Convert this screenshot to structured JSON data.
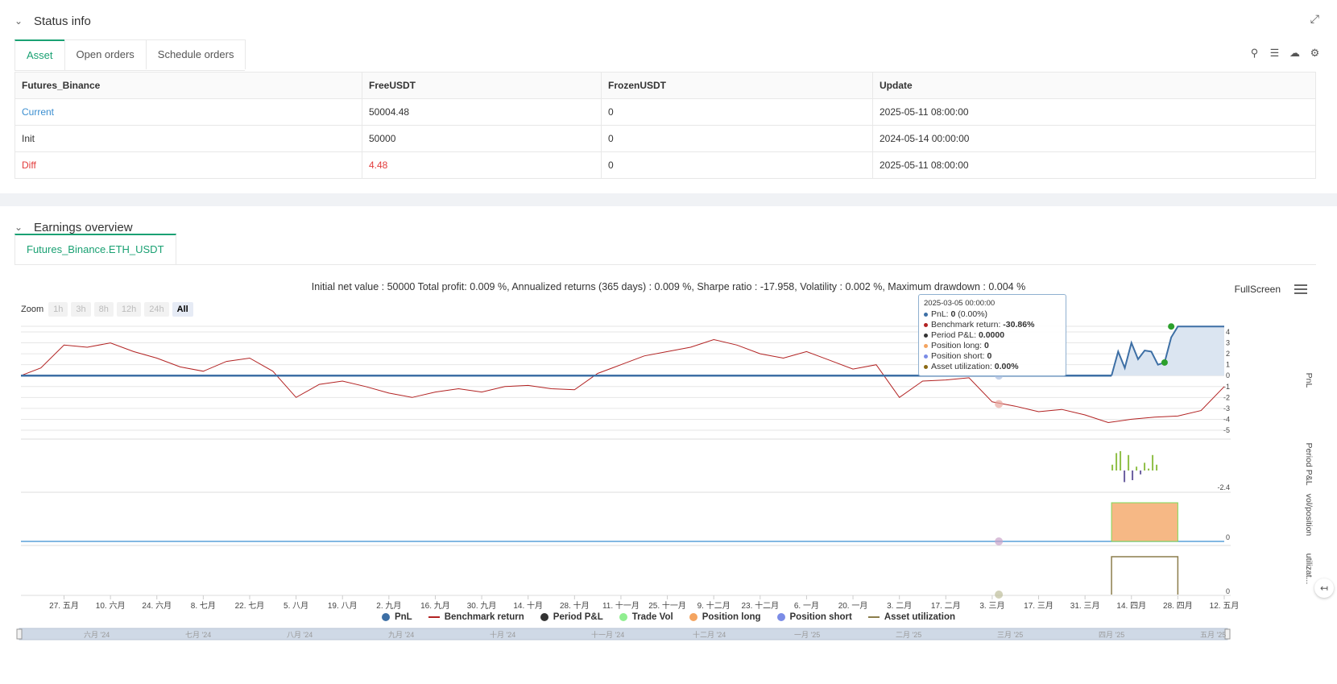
{
  "status": {
    "title": "Status info",
    "tabs": [
      "Asset",
      "Open orders",
      "Schedule orders"
    ],
    "table": {
      "headers": [
        "Futures_Binance",
        "FreeUSDT",
        "FrozenUSDT",
        "Update"
      ],
      "rows": [
        [
          "Current",
          "50004.48",
          "0",
          "2025-05-11 08:00:00"
        ],
        [
          "Init",
          "50000",
          "0",
          "2024-05-14 00:00:00"
        ],
        [
          "Diff",
          "4.48",
          "0",
          "2025-05-11 08:00:00"
        ]
      ]
    }
  },
  "earnings": {
    "title": "Earnings overview",
    "tab": "Futures_Binance.ETH_USDT",
    "summary": "Initial net value : 50000 Total profit: 0.009 %, Annualized returns (365 days) : 0.009 %, Sharpe ratio : -17.958, Volatility : 0.002 %, Maximum drawdown : 0.004 %",
    "fullscreen": "FullScreen",
    "zoom": {
      "label": "Zoom",
      "options": [
        "1h",
        "3h",
        "8h",
        "12h",
        "24h",
        "All"
      ],
      "active": "All"
    },
    "tooltip": {
      "date": "2025-03-05 00:00:00",
      "rows": [
        {
          "label": "PnL: ",
          "value": "0",
          "extra": " (0.00%)",
          "color": "#3d6fa5"
        },
        {
          "label": "Benchmark return: ",
          "value": "-30.86%",
          "extra": "",
          "color": "#b22222"
        },
        {
          "label": "Period P&L: ",
          "value": "0.0000",
          "extra": "",
          "color": "#333333"
        },
        {
          "label": "Position long: ",
          "value": "0",
          "extra": "",
          "color": "#f4a460"
        },
        {
          "label": "Position short: ",
          "value": "0",
          "extra": "",
          "color": "#7b8ce6"
        },
        {
          "label": "Asset utilization: ",
          "value": "0.00%",
          "extra": "",
          "color": "#8b6914"
        }
      ]
    },
    "legend": [
      {
        "label": "PnL",
        "type": "circle",
        "color": "#3d6fa5"
      },
      {
        "label": "Benchmark return",
        "type": "line",
        "color": "#b22222"
      },
      {
        "label": "Period P&L",
        "type": "circle",
        "color": "#333333"
      },
      {
        "label": "Trade Vol",
        "type": "circle",
        "color": "#90ee90"
      },
      {
        "label": "Position long",
        "type": "circle",
        "color": "#f4a460"
      },
      {
        "label": "Position short",
        "type": "circle",
        "color": "#7b8ce6"
      },
      {
        "label": "Asset utilization",
        "type": "line",
        "color": "#8b7d4b"
      }
    ],
    "axis_titles": [
      "PnL",
      "Period P&L",
      "vol/position",
      "utilizat..."
    ],
    "navigator_labels": [
      "六月 '24",
      "七月 '24",
      "八月 '24",
      "九月 '24",
      "十月 '24",
      "十一月 '24",
      "十二月 '24",
      "一月 '25",
      "二月 '25",
      "三月 '25",
      "四月 '25",
      "五月 '25"
    ]
  },
  "chart_data": {
    "type": "line",
    "x_tick_labels": [
      "27. 五月",
      "10. 六月",
      "24. 六月",
      "8. 七月",
      "22. 七月",
      "5. 八月",
      "19. 八月",
      "2. 九月",
      "16. 九月",
      "30. 九月",
      "14. 十月",
      "28. 十月",
      "11. 十一月",
      "25. 十一月",
      "9. 十二月",
      "23. 十二月",
      "6. 一月",
      "20. 一月",
      "3. 二月",
      "17. 二月",
      "3. 三月",
      "17. 三月",
      "31. 三月",
      "14. 四月",
      "28. 四月",
      "12. 五月"
    ],
    "pnl_y_ticks": [
      4,
      3,
      2,
      1,
      0,
      -1,
      -2,
      -3,
      -4,
      -5
    ],
    "pnl_ylim": [
      -5,
      4
    ],
    "period_pnl_tick": "-2.4",
    "vol_tick": "0",
    "util_tick": "0",
    "series": [
      {
        "name": "PnL",
        "dates": [
          "2025-04-08",
          "2025-04-10",
          "2025-04-12",
          "2025-04-14",
          "2025-04-16",
          "2025-04-18",
          "2025-04-20",
          "2025-04-22",
          "2025-04-24",
          "2025-04-26",
          "2025-04-28",
          "2025-05-12"
        ],
        "values": [
          0,
          2.2,
          0.7,
          3.0,
          1.5,
          2.3,
          2.2,
          1.0,
          1.2,
          3.5,
          4.5,
          4.5
        ]
      },
      {
        "name": "Benchmark return",
        "dates": [
          "2024-05-14",
          "2024-05-20",
          "2024-05-27",
          "2024-06-03",
          "2024-06-10",
          "2024-06-17",
          "2024-06-24",
          "2024-07-01",
          "2024-07-08",
          "2024-07-15",
          "2024-07-22",
          "2024-07-29",
          "2024-08-05",
          "2024-08-12",
          "2024-08-19",
          "2024-08-26",
          "2024-09-02",
          "2024-09-09",
          "2024-09-16",
          "2024-09-23",
          "2024-09-30",
          "2024-10-07",
          "2024-10-14",
          "2024-10-21",
          "2024-10-28",
          "2024-11-04",
          "2024-11-11",
          "2024-11-18",
          "2024-11-25",
          "2024-12-02",
          "2024-12-09",
          "2024-12-16",
          "2024-12-23",
          "2024-12-30",
          "2025-01-06",
          "2025-01-13",
          "2025-01-20",
          "2025-01-27",
          "2025-02-03",
          "2025-02-10",
          "2025-02-17",
          "2025-02-24",
          "2025-03-03",
          "2025-03-10",
          "2025-03-17",
          "2025-03-24",
          "2025-03-31",
          "2025-04-07",
          "2025-04-14",
          "2025-04-21",
          "2025-04-28",
          "2025-05-05",
          "2025-05-12"
        ],
        "values": [
          0,
          0.7,
          2.8,
          2.6,
          3.0,
          2.2,
          1.6,
          0.8,
          0.4,
          1.3,
          1.6,
          0.4,
          -2.0,
          -0.8,
          -0.5,
          -1.0,
          -1.6,
          -2.0,
          -1.5,
          -1.2,
          -1.5,
          -1.0,
          -0.9,
          -1.2,
          -1.3,
          0.2,
          1.0,
          1.8,
          2.2,
          2.6,
          3.3,
          2.8,
          2.0,
          1.6,
          2.2,
          1.4,
          0.6,
          1.0,
          -2.0,
          -0.5,
          -0.4,
          -0.2,
          -2.4,
          -2.8,
          -3.3,
          -3.1,
          -3.6,
          -4.3,
          -4.0,
          -3.8,
          -3.7,
          -3.2,
          -1.0
        ]
      }
    ]
  }
}
